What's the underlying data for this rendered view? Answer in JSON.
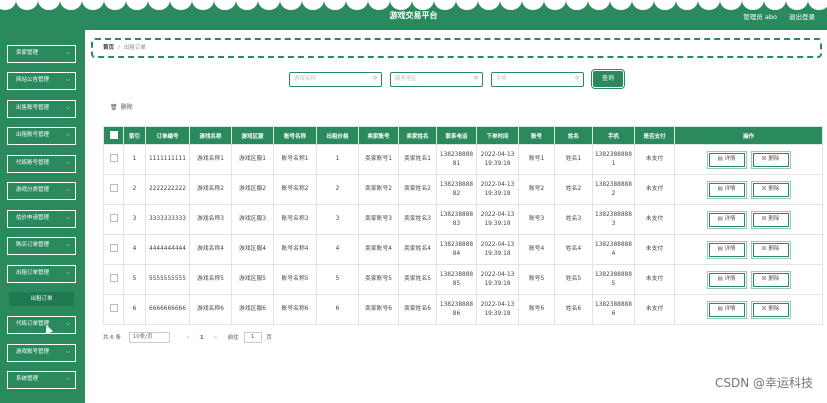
{
  "header": {
    "title": "游戏交易平台",
    "user": "管理员 abo",
    "logout": "退出登录"
  },
  "sidebar": {
    "items": [
      {
        "label": "卖家管理"
      },
      {
        "label": "网站公告管理"
      },
      {
        "label": "出售账号管理"
      },
      {
        "label": "出租账号管理"
      },
      {
        "label": "代练账号管理"
      },
      {
        "label": "游戏分类管理"
      },
      {
        "label": "估价申请管理"
      },
      {
        "label": "购买订单管理"
      },
      {
        "label": "出租订单管理"
      },
      {
        "label": "代练订单管理"
      },
      {
        "label": "游戏账号管理"
      },
      {
        "label": "系统管理"
      }
    ],
    "active_sub": "出租订单"
  },
  "breadcrumb": {
    "home": "首页",
    "sep": "/",
    "current": "出租订单"
  },
  "search": {
    "game_name_placeholder": "游戏名称",
    "area_placeholder": "服务地区",
    "phone_placeholder": "手机",
    "button": "查询"
  },
  "toolbar": {
    "delete": "删除"
  },
  "table": {
    "headers": [
      "索引",
      "订单编号",
      "游戏名称",
      "游戏区服",
      "账号名称",
      "出租价格",
      "卖家账号",
      "卖家姓名",
      "联系电话",
      "下单时间",
      "账号",
      "姓名",
      "手机",
      "是否支付",
      "操作"
    ],
    "rows": [
      {
        "index": "1",
        "order_no": "1111111111",
        "game": "游戏名称1",
        "server": "游戏区服1",
        "account_name": "账号名称1",
        "price": "1",
        "seller_account": "卖家账号1",
        "seller_name": "卖家姓名1",
        "contact": "13823888881",
        "time": "2022-04-13 19:39:18",
        "account": "账号1",
        "name": "姓名1",
        "mobile": "13823888881",
        "paid": "未支付"
      },
      {
        "index": "2",
        "order_no": "2222222222",
        "game": "游戏名称2",
        "server": "游戏区服2",
        "account_name": "账号名称2",
        "price": "2",
        "seller_account": "卖家账号2",
        "seller_name": "卖家姓名2",
        "contact": "13823888882",
        "time": "2022-04-13 19:39:18",
        "account": "账号2",
        "name": "姓名2",
        "mobile": "13823888882",
        "paid": "未支付"
      },
      {
        "index": "3",
        "order_no": "3333333333",
        "game": "游戏名称3",
        "server": "游戏区服3",
        "account_name": "账号名称3",
        "price": "3",
        "seller_account": "卖家账号3",
        "seller_name": "卖家姓名3",
        "contact": "13823888883",
        "time": "2022-04-13 19:39:18",
        "account": "账号3",
        "name": "姓名3",
        "mobile": "13823888883",
        "paid": "未支付"
      },
      {
        "index": "4",
        "order_no": "4444444444",
        "game": "游戏名称4",
        "server": "游戏区服4",
        "account_name": "账号名称4",
        "price": "4",
        "seller_account": "卖家账号4",
        "seller_name": "卖家姓名4",
        "contact": "13823888884",
        "time": "2022-04-13 19:39:18",
        "account": "账号4",
        "name": "姓名4",
        "mobile": "13823888884",
        "paid": "未支付"
      },
      {
        "index": "5",
        "order_no": "5555555555",
        "game": "游戏名称5",
        "server": "游戏区服5",
        "account_name": "账号名称5",
        "price": "5",
        "seller_account": "卖家账号5",
        "seller_name": "卖家姓名5",
        "contact": "13823888885",
        "time": "2022-04-13 19:39:18",
        "account": "账号5",
        "name": "姓名5",
        "mobile": "13823888885",
        "paid": "未支付"
      },
      {
        "index": "6",
        "order_no": "6666666666",
        "game": "游戏名称6",
        "server": "游戏区服6",
        "account_name": "账号名称6",
        "price": "6",
        "seller_account": "卖家账号6",
        "seller_name": "卖家姓名6",
        "contact": "13823888886",
        "time": "2022-04-13 19:39:18",
        "account": "账号6",
        "name": "姓名6",
        "mobile": "13823888886",
        "paid": "未支付"
      }
    ],
    "detail_label": "详情",
    "delete_label": "删除"
  },
  "pagination": {
    "total": "共 6 条",
    "page_size": "10条/页",
    "prev": "<",
    "current": "1",
    "next": ">",
    "goto_prefix": "前往",
    "goto_value": "1",
    "goto_suffix": "页"
  },
  "watermark": "CSDN @幸运科技",
  "colors": {
    "primary": "#2a8a5e",
    "white": "#ffffff"
  }
}
